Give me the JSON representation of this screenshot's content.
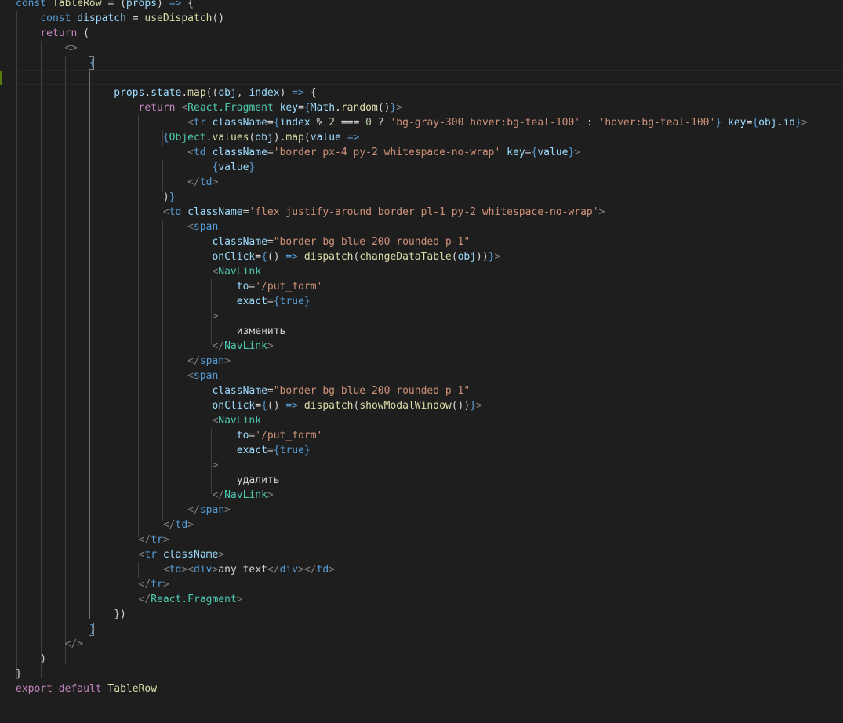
{
  "editor": {
    "lines": [
      [
        [
          "kw",
          "const "
        ],
        [
          "fn",
          "TableRow"
        ],
        [
          "txt",
          " = ("
        ],
        [
          "var",
          "props"
        ],
        [
          "txt",
          ") "
        ],
        [
          "kw",
          "=>"
        ],
        [
          "txt",
          " {"
        ]
      ],
      [
        [
          "txt",
          "    "
        ],
        [
          "kw",
          "const "
        ],
        [
          "var",
          "dispatch"
        ],
        [
          "txt",
          " = "
        ],
        [
          "fn",
          "useDispatch"
        ],
        [
          "txt",
          "()"
        ]
      ],
      [
        [
          "txt",
          "    "
        ],
        [
          "ctrl",
          "return"
        ],
        [
          "txt",
          " ("
        ]
      ],
      [
        [
          "txt",
          "        "
        ],
        [
          "punc",
          "<>"
        ]
      ],
      [
        [
          "txt",
          "            "
        ],
        [
          "brace",
          "{"
        ]
      ],
      [],
      [
        [
          "txt",
          "                "
        ],
        [
          "var",
          "props"
        ],
        [
          "txt",
          "."
        ],
        [
          "var",
          "state"
        ],
        [
          "txt",
          "."
        ],
        [
          "fn",
          "map"
        ],
        [
          "txt",
          "(("
        ],
        [
          "var",
          "obj"
        ],
        [
          "txt",
          ", "
        ],
        [
          "var",
          "index"
        ],
        [
          "txt",
          ") "
        ],
        [
          "kw",
          "=>"
        ],
        [
          "txt",
          " {"
        ]
      ],
      [
        [
          "txt",
          "                    "
        ],
        [
          "ctrl",
          "return"
        ],
        [
          "txt",
          " "
        ],
        [
          "punc",
          "<"
        ],
        [
          "comp",
          "React.Fragment"
        ],
        [
          "txt",
          " "
        ],
        [
          "attr",
          "key"
        ],
        [
          "txt",
          "="
        ],
        [
          "brace",
          "{"
        ],
        [
          "var",
          "Math"
        ],
        [
          "txt",
          "."
        ],
        [
          "fn",
          "random"
        ],
        [
          "txt",
          "()"
        ],
        [
          "brace",
          "}"
        ],
        [
          "punc",
          ">"
        ]
      ],
      [
        [
          "txt",
          "                            "
        ],
        [
          "punc",
          "<"
        ],
        [
          "tag",
          "tr"
        ],
        [
          "txt",
          " "
        ],
        [
          "attr",
          "className"
        ],
        [
          "txt",
          "="
        ],
        [
          "brace",
          "{"
        ],
        [
          "var",
          "index"
        ],
        [
          "txt",
          " % "
        ],
        [
          "num",
          "2"
        ],
        [
          "txt",
          " === "
        ],
        [
          "num",
          "0"
        ],
        [
          "txt",
          " ? "
        ],
        [
          "str",
          "'bg-gray-300 hover:bg-teal-100'"
        ],
        [
          "txt",
          " : "
        ],
        [
          "str",
          "'hover:bg-teal-100'"
        ],
        [
          "brace",
          "}"
        ],
        [
          "txt",
          " "
        ],
        [
          "attr",
          "key"
        ],
        [
          "txt",
          "="
        ],
        [
          "brace",
          "{"
        ],
        [
          "var",
          "obj"
        ],
        [
          "txt",
          "."
        ],
        [
          "var",
          "id"
        ],
        [
          "brace",
          "}"
        ],
        [
          "punc",
          ">"
        ]
      ],
      [
        [
          "txt",
          "                        "
        ],
        [
          "brace",
          "{"
        ],
        [
          "comp",
          "Object"
        ],
        [
          "txt",
          "."
        ],
        [
          "fn",
          "values"
        ],
        [
          "txt",
          "("
        ],
        [
          "var",
          "obj"
        ],
        [
          "txt",
          ")."
        ],
        [
          "fn",
          "map"
        ],
        [
          "txt",
          "("
        ],
        [
          "var",
          "value"
        ],
        [
          "txt",
          " "
        ],
        [
          "kw",
          "=>"
        ]
      ],
      [
        [
          "txt",
          "                            "
        ],
        [
          "punc",
          "<"
        ],
        [
          "tag",
          "td"
        ],
        [
          "txt",
          " "
        ],
        [
          "attr",
          "className"
        ],
        [
          "txt",
          "="
        ],
        [
          "str",
          "'border px-4 py-2 whitespace-no-wrap'"
        ],
        [
          "txt",
          " "
        ],
        [
          "attr",
          "key"
        ],
        [
          "txt",
          "="
        ],
        [
          "brace",
          "{"
        ],
        [
          "var",
          "value"
        ],
        [
          "brace",
          "}"
        ],
        [
          "punc",
          ">"
        ]
      ],
      [
        [
          "txt",
          "                                "
        ],
        [
          "brace",
          "{"
        ],
        [
          "var",
          "value"
        ],
        [
          "brace",
          "}"
        ]
      ],
      [
        [
          "txt",
          "                            "
        ],
        [
          "punc",
          "</"
        ],
        [
          "tag",
          "td"
        ],
        [
          "punc",
          ">"
        ]
      ],
      [
        [
          "txt",
          "                        )"
        ],
        [
          "brace",
          "}"
        ]
      ],
      [
        [
          "txt",
          "                        "
        ],
        [
          "punc",
          "<"
        ],
        [
          "tag",
          "td"
        ],
        [
          "txt",
          " "
        ],
        [
          "attr",
          "className"
        ],
        [
          "txt",
          "="
        ],
        [
          "str",
          "'flex justify-around border pl-1 py-2 whitespace-no-wrap'"
        ],
        [
          "punc",
          ">"
        ]
      ],
      [
        [
          "txt",
          "                            "
        ],
        [
          "punc",
          "<"
        ],
        [
          "tag",
          "span"
        ]
      ],
      [
        [
          "txt",
          "                                "
        ],
        [
          "attr",
          "className"
        ],
        [
          "txt",
          "="
        ],
        [
          "str",
          "\"border bg-blue-200 rounded p-1\""
        ]
      ],
      [
        [
          "txt",
          "                                "
        ],
        [
          "attr",
          "onClick"
        ],
        [
          "txt",
          "="
        ],
        [
          "brace",
          "{"
        ],
        [
          "txt",
          "() "
        ],
        [
          "kw",
          "=>"
        ],
        [
          "txt",
          " "
        ],
        [
          "fn",
          "dispatch"
        ],
        [
          "txt",
          "("
        ],
        [
          "fn",
          "changeDataTable"
        ],
        [
          "txt",
          "("
        ],
        [
          "var",
          "obj"
        ],
        [
          "txt",
          "))"
        ],
        [
          "brace",
          "}"
        ],
        [
          "punc",
          ">"
        ]
      ],
      [
        [
          "txt",
          "                                "
        ],
        [
          "punc",
          "<"
        ],
        [
          "comp",
          "NavLink"
        ]
      ],
      [
        [
          "txt",
          "                                    "
        ],
        [
          "attr",
          "to"
        ],
        [
          "txt",
          "="
        ],
        [
          "str",
          "'/put_form'"
        ]
      ],
      [
        [
          "txt",
          "                                    "
        ],
        [
          "attr",
          "exact"
        ],
        [
          "txt",
          "="
        ],
        [
          "brace",
          "{"
        ],
        [
          "kw",
          "true"
        ],
        [
          "brace",
          "}"
        ]
      ],
      [
        [
          "txt",
          "                                "
        ],
        [
          "punc",
          ">"
        ]
      ],
      [
        [
          "txt",
          "                                    "
        ],
        [
          "txt",
          "изменить"
        ]
      ],
      [
        [
          "txt",
          "                                "
        ],
        [
          "punc",
          "</"
        ],
        [
          "comp",
          "NavLink"
        ],
        [
          "punc",
          ">"
        ]
      ],
      [
        [
          "txt",
          "                            "
        ],
        [
          "punc",
          "</"
        ],
        [
          "tag",
          "span"
        ],
        [
          "punc",
          ">"
        ]
      ],
      [
        [
          "txt",
          "                            "
        ],
        [
          "punc",
          "<"
        ],
        [
          "tag",
          "span"
        ]
      ],
      [
        [
          "txt",
          "                                "
        ],
        [
          "attr",
          "className"
        ],
        [
          "txt",
          "="
        ],
        [
          "str",
          "\"border bg-blue-200 rounded p-1\""
        ]
      ],
      [
        [
          "txt",
          "                                "
        ],
        [
          "attr",
          "onClick"
        ],
        [
          "txt",
          "="
        ],
        [
          "brace",
          "{"
        ],
        [
          "txt",
          "() "
        ],
        [
          "kw",
          "=>"
        ],
        [
          "txt",
          " "
        ],
        [
          "fn",
          "dispatch"
        ],
        [
          "txt",
          "("
        ],
        [
          "fn",
          "showModalWindow"
        ],
        [
          "txt",
          "())"
        ],
        [
          "brace",
          "}"
        ],
        [
          "punc",
          ">"
        ]
      ],
      [
        [
          "txt",
          "                                "
        ],
        [
          "punc",
          "<"
        ],
        [
          "comp",
          "NavLink"
        ]
      ],
      [
        [
          "txt",
          "                                    "
        ],
        [
          "attr",
          "to"
        ],
        [
          "txt",
          "="
        ],
        [
          "str",
          "'/put_form'"
        ]
      ],
      [
        [
          "txt",
          "                                    "
        ],
        [
          "attr",
          "exact"
        ],
        [
          "txt",
          "="
        ],
        [
          "brace",
          "{"
        ],
        [
          "kw",
          "true"
        ],
        [
          "brace",
          "}"
        ]
      ],
      [
        [
          "txt",
          "                                "
        ],
        [
          "punc",
          ">"
        ]
      ],
      [
        [
          "txt",
          "                                    "
        ],
        [
          "txt",
          "удалить"
        ]
      ],
      [
        [
          "txt",
          "                                "
        ],
        [
          "punc",
          "</"
        ],
        [
          "comp",
          "NavLink"
        ],
        [
          "punc",
          ">"
        ]
      ],
      [
        [
          "txt",
          "                            "
        ],
        [
          "punc",
          "</"
        ],
        [
          "tag",
          "span"
        ],
        [
          "punc",
          ">"
        ]
      ],
      [
        [
          "txt",
          "                        "
        ],
        [
          "punc",
          "</"
        ],
        [
          "tag",
          "td"
        ],
        [
          "punc",
          ">"
        ]
      ],
      [
        [
          "txt",
          "                    "
        ],
        [
          "punc",
          "</"
        ],
        [
          "tag",
          "tr"
        ],
        [
          "punc",
          ">"
        ]
      ],
      [
        [
          "txt",
          "                    "
        ],
        [
          "punc",
          "<"
        ],
        [
          "tag",
          "tr"
        ],
        [
          "txt",
          " "
        ],
        [
          "attr",
          "className"
        ],
        [
          "punc",
          ">"
        ]
      ],
      [
        [
          "txt",
          "                        "
        ],
        [
          "punc",
          "<"
        ],
        [
          "tag",
          "td"
        ],
        [
          "punc",
          "><"
        ],
        [
          "tag",
          "div"
        ],
        [
          "punc",
          ">"
        ],
        [
          "txt",
          "any text"
        ],
        [
          "punc",
          "</"
        ],
        [
          "tag",
          "div"
        ],
        [
          "punc",
          "></"
        ],
        [
          "tag",
          "td"
        ],
        [
          "punc",
          ">"
        ]
      ],
      [
        [
          "txt",
          "                    "
        ],
        [
          "punc",
          "</"
        ],
        [
          "tag",
          "tr"
        ],
        [
          "punc",
          ">"
        ]
      ],
      [
        [
          "txt",
          "                    "
        ],
        [
          "punc",
          "</"
        ],
        [
          "comp",
          "React.Fragment"
        ],
        [
          "punc",
          ">"
        ]
      ],
      [
        [
          "txt",
          "                "
        ],
        [
          "txt",
          "})"
        ]
      ],
      [
        [
          "txt",
          "            "
        ],
        [
          "brace",
          "}"
        ]
      ],
      [
        [
          "txt",
          "        "
        ],
        [
          "punc",
          "</>"
        ]
      ],
      [
        [
          "txt",
          "    )"
        ]
      ],
      [
        [
          "txt",
          "}"
        ]
      ],
      [
        [
          "ctrl",
          "export"
        ],
        [
          "txt",
          " "
        ],
        [
          "ctrl",
          "default"
        ],
        [
          "txt",
          " "
        ],
        [
          "fn",
          "TableRow"
        ]
      ]
    ]
  }
}
